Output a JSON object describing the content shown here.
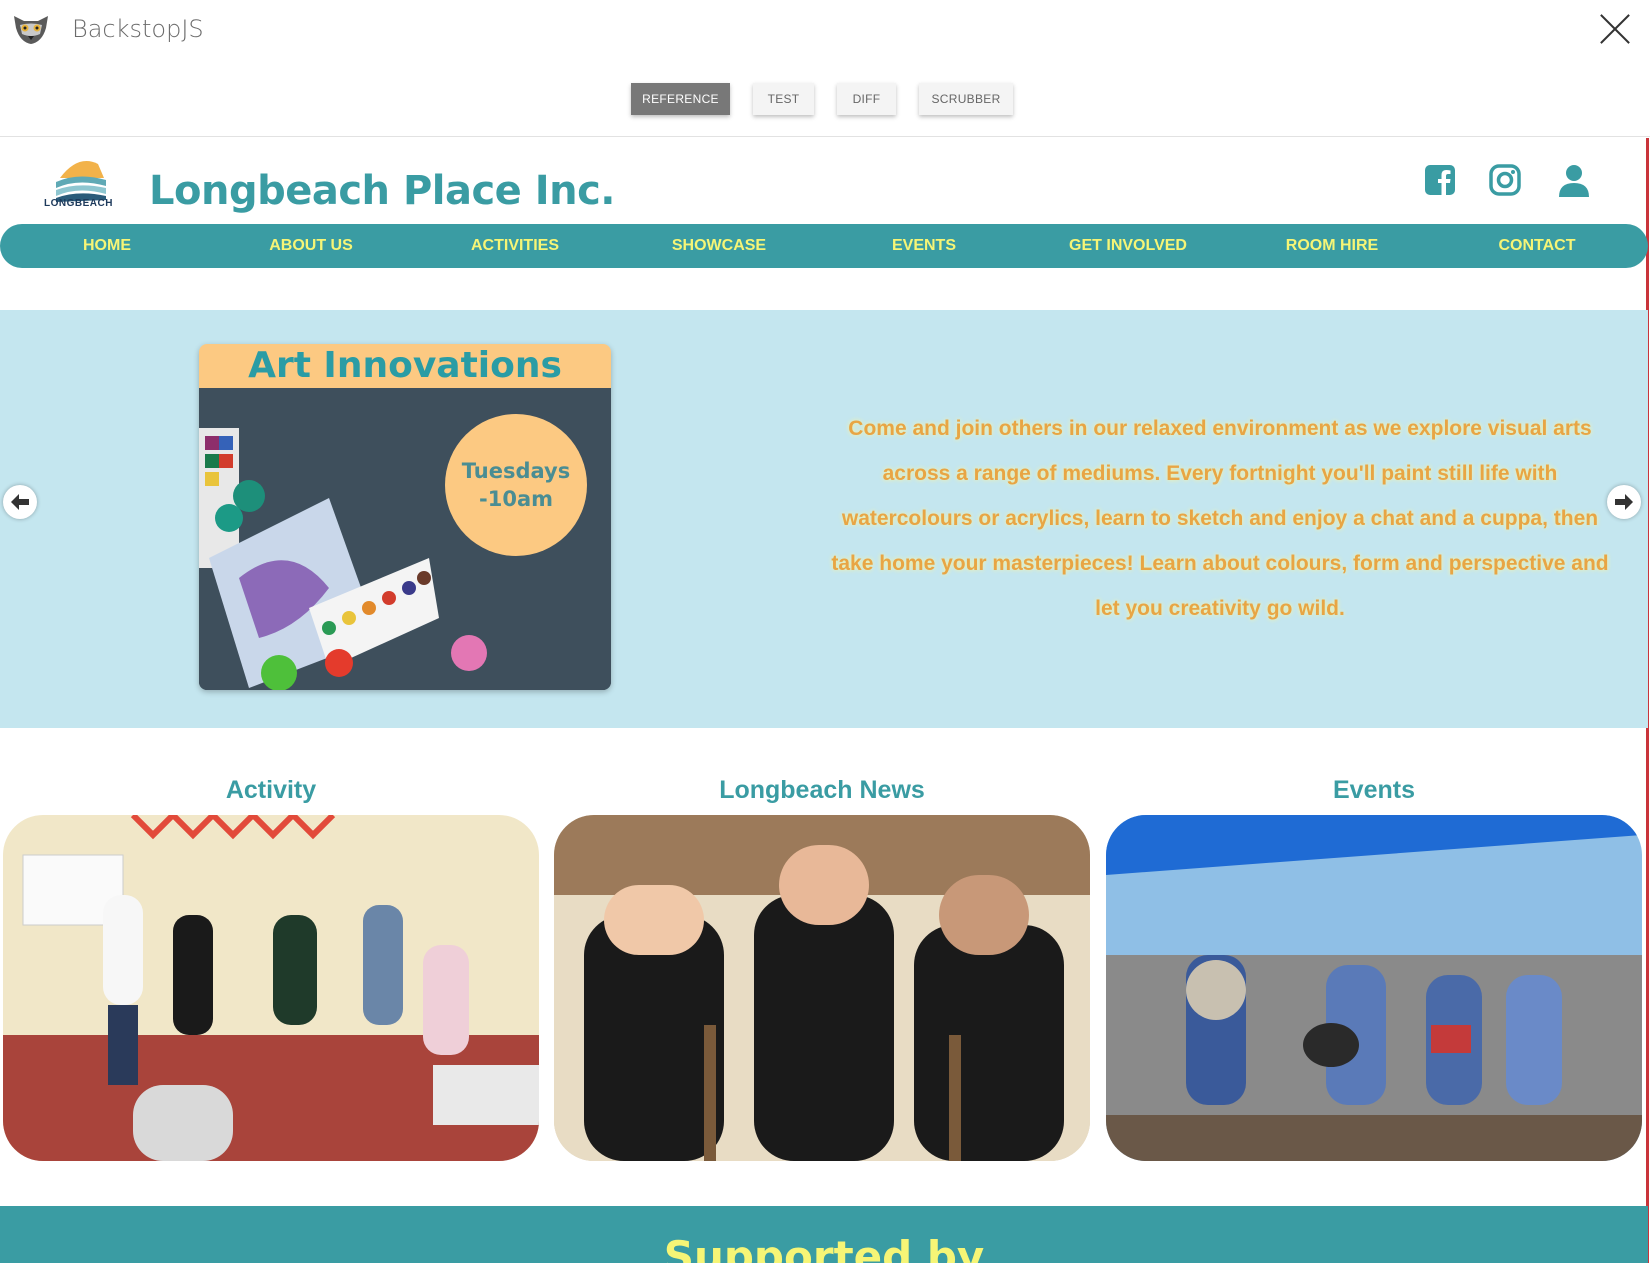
{
  "app": {
    "title": "BackstopJS"
  },
  "tabs": [
    "REFERENCE",
    "TEST",
    "DIFF",
    "SCRUBBER"
  ],
  "site": {
    "title": "Longbeach Place Inc.",
    "logo_text": "LONGBEACH",
    "nav": [
      "HOME",
      "ABOUT US",
      "ACTIVITIES",
      "SHOWCASE",
      "EVENTS",
      "GET INVOLVED",
      "ROOM HIRE",
      "CONTACT"
    ]
  },
  "hero": {
    "card_title": "Art Innovations",
    "badge_line1": "Tuesdays",
    "badge_line2": "-10am",
    "text": "Come and join others in our relaxed environment as we explore visual arts across a range of mediums. Every fortnight you'll paint still life with watercolours or acrylics, learn to sketch and enjoy a chat and a cuppa, then take home your masterpieces! Learn about colours, form and perspective and let you creativity go wild."
  },
  "sections": [
    {
      "title": "Activity"
    },
    {
      "title": "Longbeach News"
    },
    {
      "title": "Events"
    }
  ],
  "footer": {
    "heading": "Supported by"
  },
  "colors": {
    "teal": "#3a9ca3",
    "yellow": "#f6f576",
    "peach": "#fcc982",
    "sky": "#c4e6ef",
    "orange_text": "#e8a544"
  },
  "icons": [
    "close-icon",
    "facebook-icon",
    "instagram-icon",
    "user-icon",
    "arrow-left-icon",
    "arrow-right-icon"
  ]
}
